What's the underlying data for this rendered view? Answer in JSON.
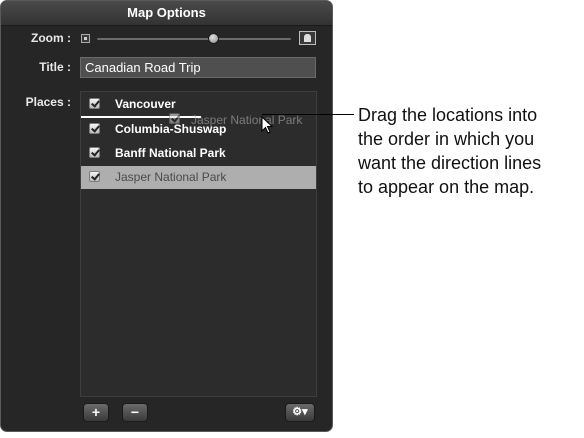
{
  "panel": {
    "title": "Map Options",
    "zoom_label": "Zoom :",
    "zoom_level": 0.6,
    "title_label": "Title :",
    "title_value": "Canadian Road Trip",
    "places_label": "Places :",
    "places": [
      {
        "label": "Vancouver",
        "checked": true,
        "selected": false
      },
      {
        "label": "Columbia-Shuswap",
        "checked": true,
        "selected": false
      },
      {
        "label": "Banff National Park",
        "checked": true,
        "selected": false
      },
      {
        "label": "Jasper National Park",
        "checked": true,
        "selected": true
      }
    ],
    "drag_ghost_label": "Jasper National Park",
    "buttons": {
      "add": "+",
      "remove": "−",
      "action": "⚙▾"
    }
  },
  "callout": {
    "lines": [
      "Drag the locations into",
      "the order in which you",
      "want the direction lines",
      "to appear on the map."
    ]
  },
  "colors": {
    "panel_bg": "#262626",
    "selected_row": "#aeaeae"
  }
}
